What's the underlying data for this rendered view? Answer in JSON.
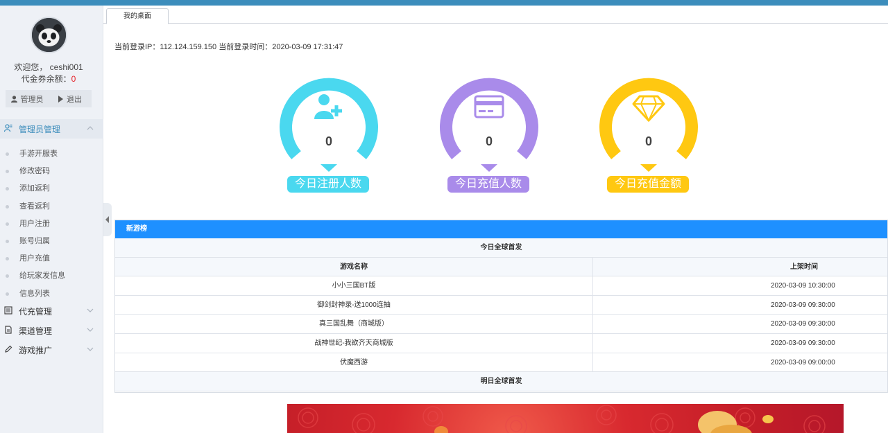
{
  "colors": {
    "accent": "#1e90ff",
    "cyan": "#4ad8ef",
    "purple": "#a98bea",
    "gold": "#ffc811",
    "red": "#e6212a"
  },
  "sidebar": {
    "welcome": "欢迎您， ceshi001",
    "balance_label": "代金券余额：",
    "balance_value": "0",
    "admin_button": "管理员",
    "logout_button": "退出",
    "groups": [
      {
        "label": "管理员管理",
        "icon": "user-group-icon",
        "expanded": true
      },
      {
        "label": "代充管理",
        "icon": "list-icon",
        "expanded": false
      },
      {
        "label": "渠道管理",
        "icon": "document-icon",
        "expanded": false
      },
      {
        "label": "游戏推广",
        "icon": "pencil-icon",
        "expanded": false
      }
    ],
    "items": [
      "手游开服表",
      "修改密码",
      "添加返利",
      "查看返利",
      "用户注册",
      "账号归属",
      "用户充值",
      "给玩家发信息",
      "信息列表"
    ]
  },
  "tabs": [
    {
      "label": "我的桌面"
    }
  ],
  "login_info": "当前登录IP：112.124.159.150 当前登录时间：2020-03-09 17:31:47",
  "stats": [
    {
      "value": "0",
      "label": "今日注册人数",
      "icon": "add-user-icon"
    },
    {
      "value": "0",
      "label": "今日充值人数",
      "icon": "credit-card-icon"
    },
    {
      "value": "0",
      "label": "今日充值金额",
      "icon": "diamond-icon"
    }
  ],
  "panel": {
    "title": "新游榜",
    "today_section": "今日全球首发",
    "col_name": "游戏名称",
    "col_time": "上架时间",
    "rows": [
      {
        "name": "小小三国BT版",
        "time": "2020-03-09 10:30:00"
      },
      {
        "name": "御剑封神录-送1000连抽",
        "time": "2020-03-09 09:30:00"
      },
      {
        "name": "真三国乱舞（商城版）",
        "time": "2020-03-09 09:30:00"
      },
      {
        "name": "战神世纪-我欲齐天商城版",
        "time": "2020-03-09 09:30:00"
      },
      {
        "name": "伏魔西游",
        "time": "2020-03-09 09:00:00"
      }
    ],
    "tomorrow_section": "明日全球首发"
  }
}
